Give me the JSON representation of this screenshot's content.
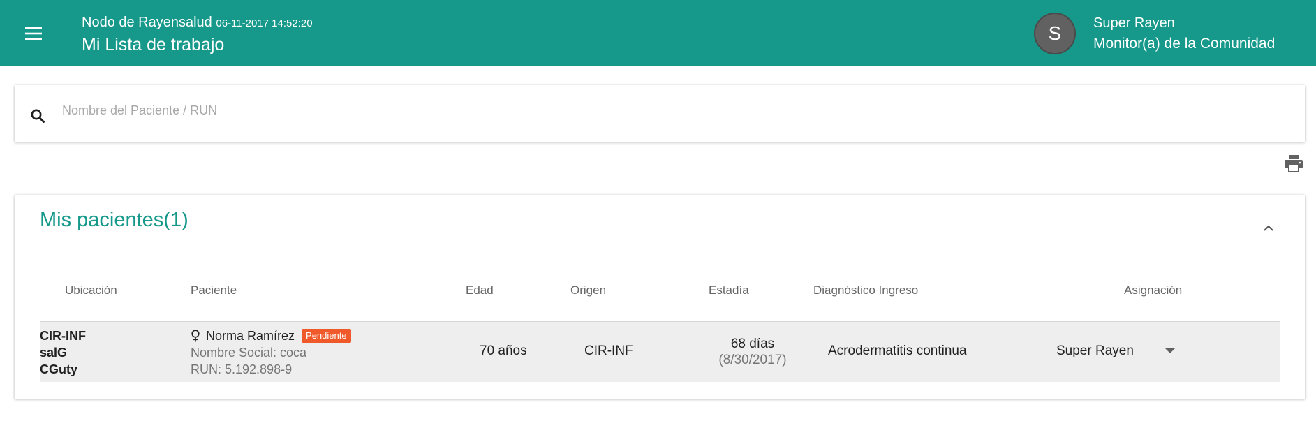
{
  "header": {
    "node_name": "Nodo de Rayensalud",
    "datetime": "06-11-2017 14:52:20",
    "title": "Mi Lista de trabajo",
    "user_initial": "S",
    "user_name": "Super Rayen",
    "user_role": "Monitor(a) de la Comunidad",
    "bar_color": "#16998b"
  },
  "search": {
    "placeholder": "Nombre del Paciente / RUN",
    "value": "",
    "icon": "search-icon"
  },
  "toolbar": {
    "print_icon": "print-icon"
  },
  "patients": {
    "title": "Mis pacientes(1)",
    "collapse_icon": "chevron-up-icon",
    "columns": [
      "Ubicación",
      "Paciente",
      "Edad",
      "Origen",
      "Estadía",
      "Diagnóstico Ingreso",
      "Asignación"
    ],
    "rows": [
      {
        "location": [
          "CIR-INF",
          "salG",
          "CGuty"
        ],
        "gender_icon": "female-icon",
        "name": "Norma Ramírez",
        "status": "Pendiente",
        "social_name": "Nombre Social: coca",
        "run": "RUN: 5.192.898-9",
        "age": "70 años",
        "origin": "CIR-INF",
        "stay_days": "68 días",
        "stay_date": "(8/30/2017)",
        "diagnosis": "Acrodermatitis continua",
        "assigned": "Super Rayen"
      }
    ]
  },
  "colors": {
    "accent": "#16998b",
    "badge": "#f05a2b",
    "row_bg": "#eeeeee"
  }
}
